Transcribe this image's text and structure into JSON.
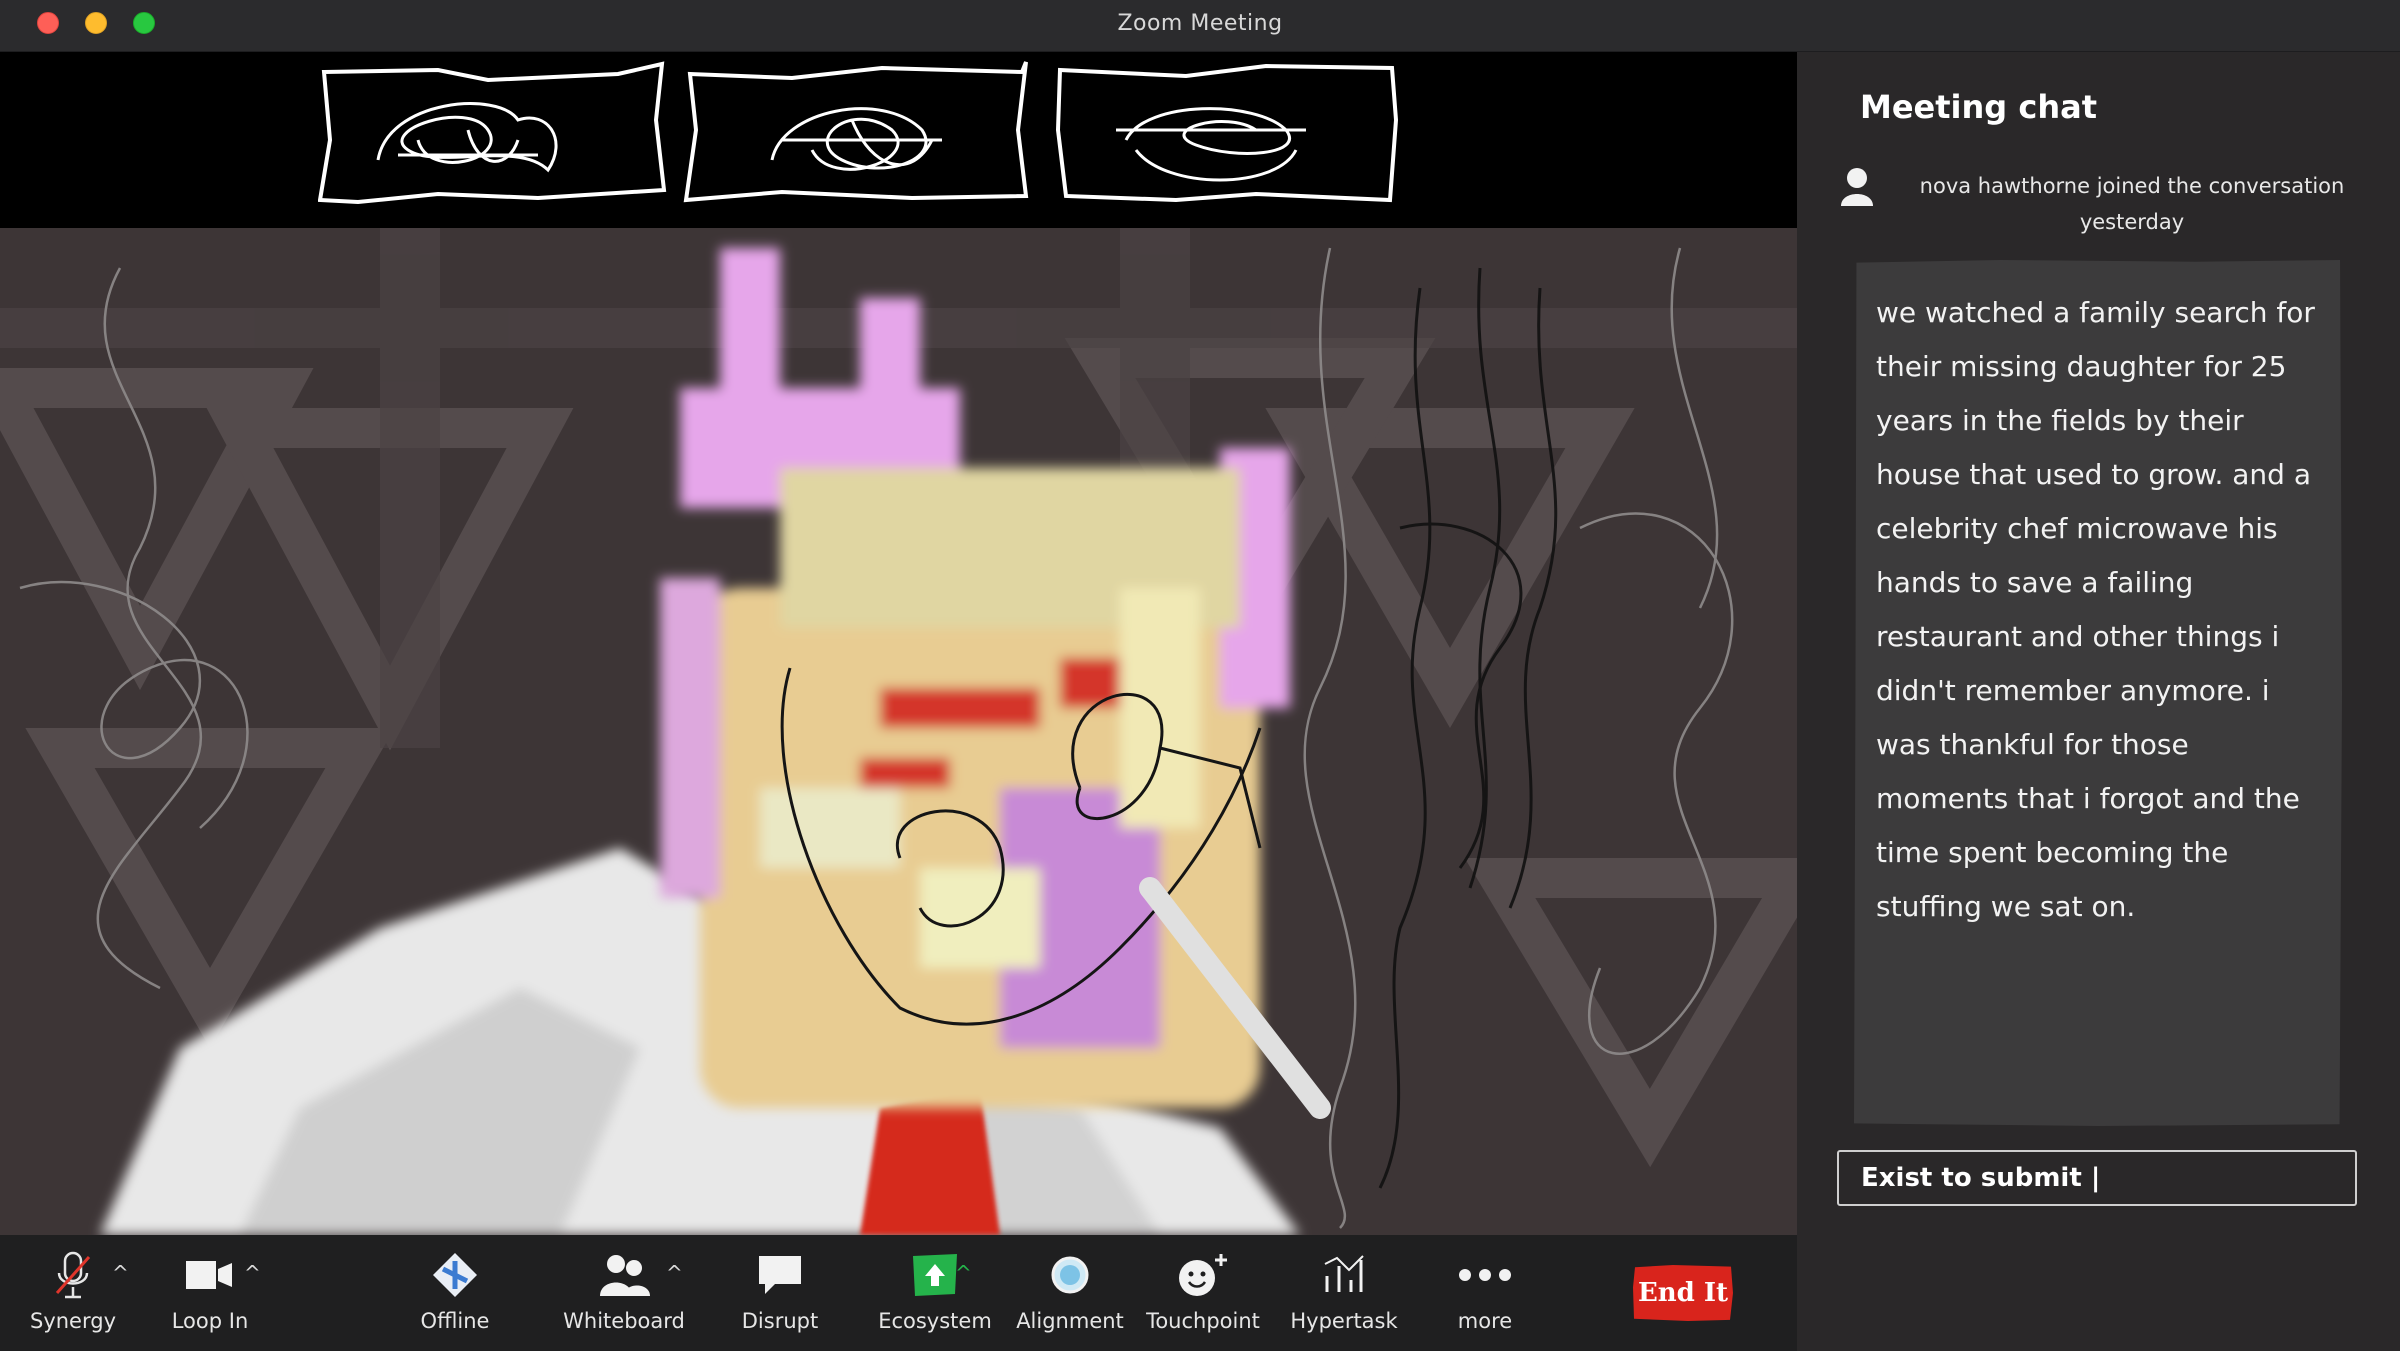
{
  "window": {
    "title": "Zoom Meeting"
  },
  "toolbar": {
    "items": [
      {
        "label": "Synergy",
        "icon": "muted-microphone-icon"
      },
      {
        "label": "Loop In",
        "icon": "video-camera-icon"
      },
      {
        "label": "Offline",
        "icon": "diamond-logo-icon"
      },
      {
        "label": "Whiteboard",
        "icon": "participants-icon"
      },
      {
        "label": "Disrupt",
        "icon": "speech-bubble-icon"
      },
      {
        "label": "Ecosystem",
        "icon": "share-screen-icon"
      },
      {
        "label": "Alignment",
        "icon": "bubble-icon"
      },
      {
        "label": "Touchpoint",
        "icon": "smiley-plus-icon"
      },
      {
        "label": "Hypertask",
        "icon": "chart-icon"
      },
      {
        "label": "more",
        "icon": "more-dots-icon"
      }
    ],
    "end_label": "End It"
  },
  "chat": {
    "title": "Meeting chat",
    "join_notice": "nova hawthorne  joined the conversation yesterday",
    "message": "we watched a family search for their missing daughter for 25 years in the fields by their house that used to grow. and a celebrity chef microwave his hands to save a failing restaurant and other things i didn't remember anymore. i was thankful for those moments that i forgot and the time spent becoming the stuffing we sat on.",
    "input_value": "Exist to submit |"
  },
  "colors": {
    "accent_end": "#d9241c",
    "ecosystem_green": "#25b34b",
    "chat_bg": "#2a2829",
    "message_bg": "#3c3b3c"
  }
}
